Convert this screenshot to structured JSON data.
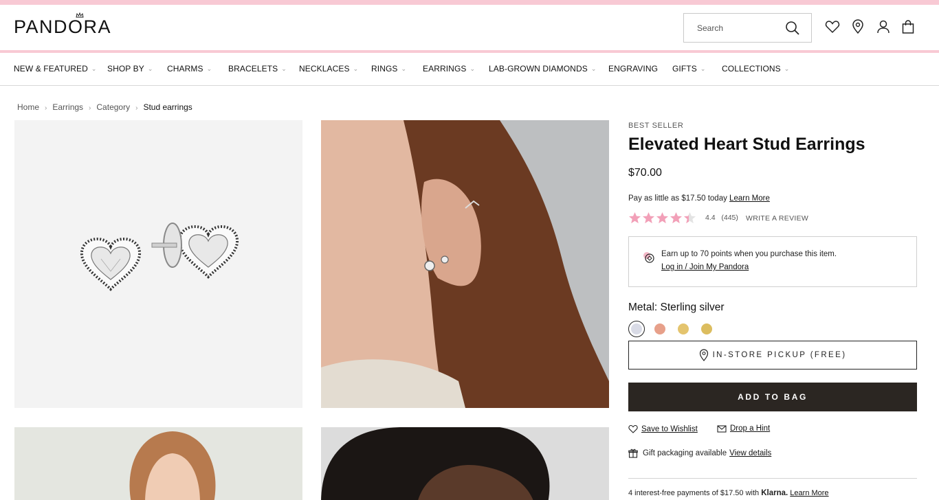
{
  "brand": {
    "logo_text": "PANDORA",
    "accent_pink": "#f8c9d4",
    "dark_button": "#2b2622",
    "star_color": "#f2a0b8"
  },
  "header": {
    "search": {
      "placeholder": "Search"
    },
    "icons": [
      "heart-icon",
      "location-pin-icon",
      "account-icon",
      "bag-icon"
    ]
  },
  "nav": {
    "items": [
      {
        "label": "NEW & FEATURED",
        "has_dropdown": true
      },
      {
        "label": "SHOP BY",
        "has_dropdown": true
      },
      {
        "label": "CHARMS",
        "has_dropdown": true
      },
      {
        "label": "BRACELETS",
        "has_dropdown": true
      },
      {
        "label": "NECKLACES",
        "has_dropdown": true
      },
      {
        "label": "RINGS",
        "has_dropdown": true
      },
      {
        "label": "EARRINGS",
        "has_dropdown": true
      },
      {
        "label": "LAB-GROWN DIAMONDS",
        "has_dropdown": true
      },
      {
        "label": "ENGRAVING",
        "has_dropdown": false
      },
      {
        "label": "GIFTS",
        "has_dropdown": true
      },
      {
        "label": "COLLECTIONS",
        "has_dropdown": true
      }
    ]
  },
  "breadcrumb": {
    "items": [
      "Home",
      "Earrings",
      "Category"
    ],
    "current": "Stud earrings"
  },
  "product": {
    "badge": "BEST SELLER",
    "title": "Elevated Heart Stud Earrings",
    "price": "$70.00",
    "pay_little_text": "Pay as little as $17.50 today",
    "pay_little_link": "Learn More",
    "rating": {
      "value": "4.4",
      "count": "(445)",
      "stars": 4.4,
      "max": 5,
      "write_review": "WRITE A REVIEW"
    },
    "points": {
      "text": "Earn up to 70 points when you purchase this item.",
      "link": "Log in / Join My Pandora"
    },
    "metal": {
      "label": "Metal: Sterling silver",
      "swatches": [
        {
          "name": "sterling-silver",
          "color": "#d9dbe6",
          "selected": true
        },
        {
          "name": "rose-gold",
          "color": "#e7a08a",
          "selected": false
        },
        {
          "name": "gold",
          "color": "#e4c46e",
          "selected": false
        },
        {
          "name": "gold-plated",
          "color": "#dcbd5f",
          "selected": false
        }
      ]
    },
    "pickup_label": "IN-STORE PICKUP (FREE)",
    "add_to_bag_label": "ADD TO BAG",
    "wishlist_label": "Save to Wishlist",
    "hint_label": "Drop a Hint",
    "gift_text": "Gift packaging available",
    "gift_link": "View details",
    "klarna": {
      "text": "4 interest-free payments of $17.50 with",
      "brand": "Klarna.",
      "link": "Learn More"
    }
  }
}
